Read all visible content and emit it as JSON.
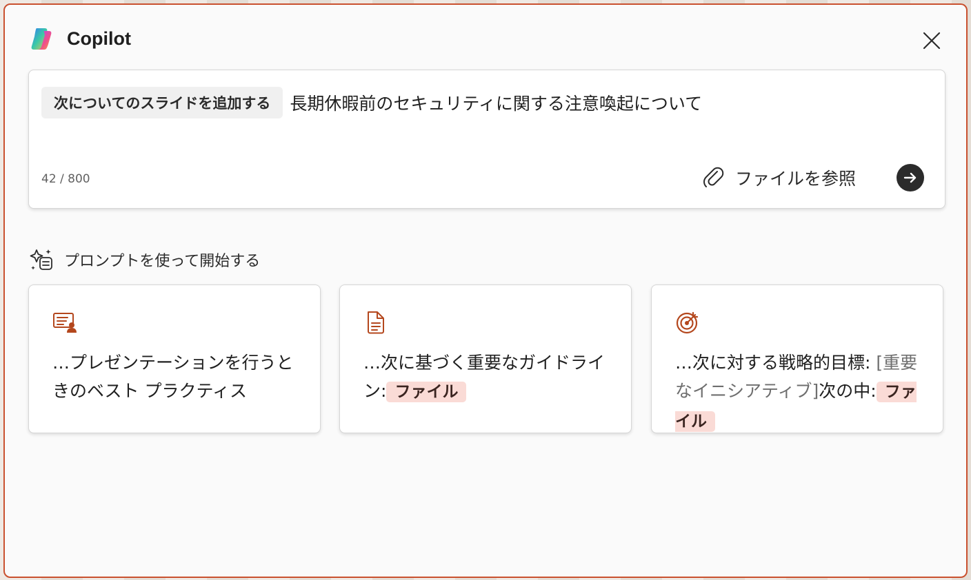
{
  "header": {
    "title": "Copilot",
    "logo_icon": "copilot-logo",
    "close_icon": "close-icon"
  },
  "input": {
    "chip_label": "次についてのスライドを追加する",
    "prompt_text": "長期休暇前のセキュリティに関する注意喚起について",
    "char_count": "42 / 800",
    "browse_label": "ファイルを参照",
    "browse_icon": "paperclip-icon",
    "send_icon": "arrow-right-icon"
  },
  "prompts": {
    "section_title": "プロンプトを使って開始する",
    "section_icon": "sparkle-list-icon",
    "cards": [
      {
        "icon": "presentation-person-icon",
        "text": "…プレゼンテーションを行うときのベスト プラクティス"
      },
      {
        "icon": "document-icon",
        "text": "…次に基づく重要なガイドライン:",
        "tag": "ファイル"
      },
      {
        "icon": "target-icon",
        "text_before": "…次に対する戦略的目標: ",
        "placeholder": "[重要なイニシアティブ]",
        "text_after": "次の中:",
        "tag": "ファイル"
      }
    ]
  },
  "colors": {
    "accent_border": "#c9502e",
    "icon_color": "#b4471d",
    "tag_bg": "#fadbd6",
    "send_bg": "#2b2b2b"
  }
}
